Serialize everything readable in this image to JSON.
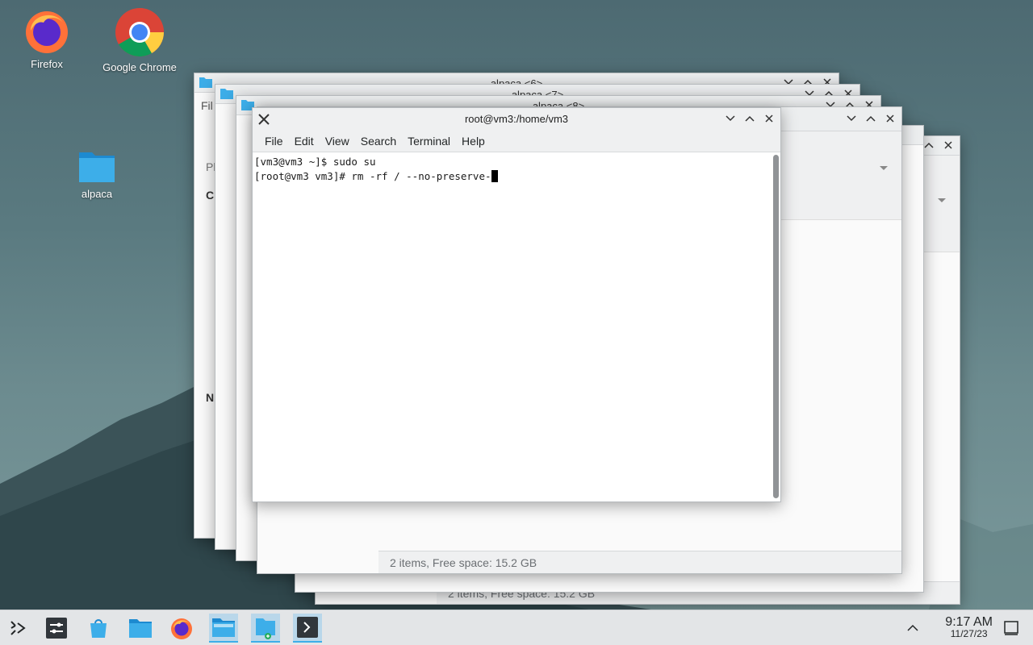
{
  "desktop": {
    "icons": [
      {
        "label": "Firefox",
        "icon": "firefox-icon"
      },
      {
        "label": "Google Chrome",
        "icon": "chrome-icon"
      },
      {
        "label": "alpaca",
        "icon": "folder-icon"
      }
    ]
  },
  "file_manager_windows": [
    {
      "title": "alpaca <6>"
    },
    {
      "title": "alpaca <7>"
    },
    {
      "title": "alpaca <8>"
    }
  ],
  "file_manager": {
    "menu_partial": "Fil",
    "status_text": "2 items, Free space: 15.2 GB",
    "sidebar_labels": [
      "Pl",
      "C",
      "N"
    ]
  },
  "terminal": {
    "title": "root@vm3:/home/vm3",
    "menu": [
      "File",
      "Edit",
      "View",
      "Search",
      "Terminal",
      "Help"
    ],
    "lines": [
      "[vm3@vm3 ~]$ sudo su",
      "[root@vm3 vm3]# rm -rf / --no-preserve-"
    ]
  },
  "taskbar": {
    "time": "9:17 AM",
    "date": "11/27/23",
    "items": [
      "app-launcher-icon",
      "system-settings-icon",
      "discover-icon",
      "file-manager-icon",
      "firefox-icon",
      "dolphin-icon",
      "folder-new-icon",
      "terminal-icon"
    ]
  },
  "colors": {
    "accent": "#3daee9",
    "panel": "#e3e5e7"
  }
}
